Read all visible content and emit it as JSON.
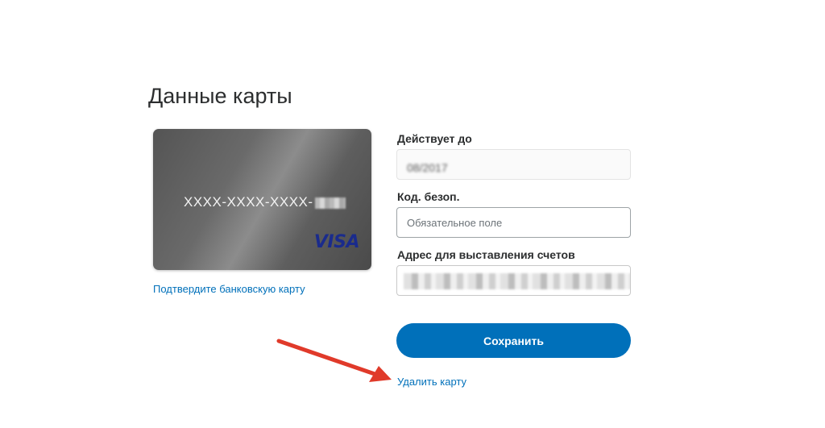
{
  "page": {
    "title": "Данные карты"
  },
  "card": {
    "number_masked": "XXXX-XXXX-XXXX-",
    "brand": "VISA",
    "confirm_link": "Подтвердите банковскую карту"
  },
  "form": {
    "expiry": {
      "label": "Действует до",
      "value": "08/2017"
    },
    "cvv": {
      "label": "Код. безоп.",
      "placeholder": "Обязательное поле"
    },
    "address": {
      "label": "Адрес для выставления счетов"
    },
    "save_label": "Сохранить",
    "delete_link": "Удалить карту"
  },
  "colors": {
    "accent": "#0070ba",
    "annotation_arrow": "#e03a2a"
  }
}
